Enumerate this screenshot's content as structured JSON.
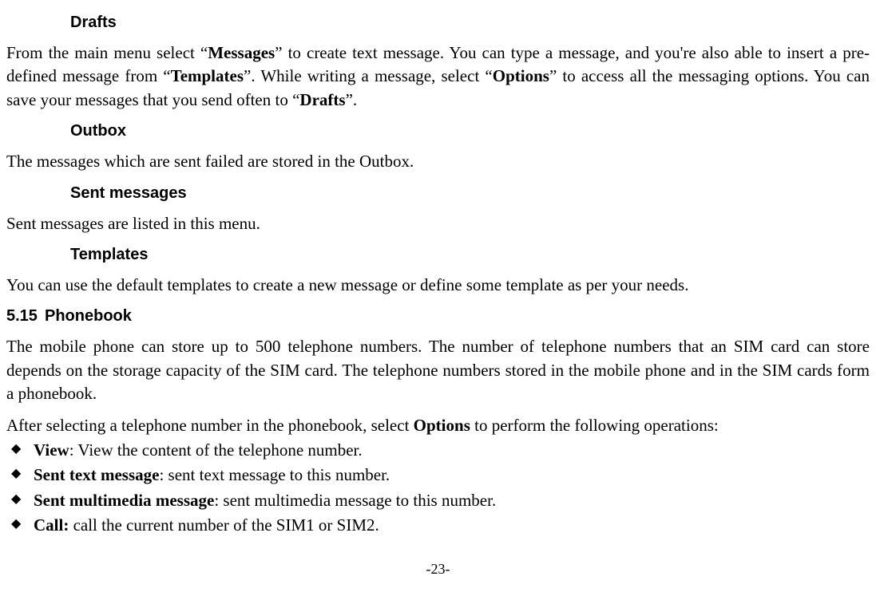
{
  "headings": {
    "drafts": "Drafts",
    "outbox": "Outbox",
    "sent_messages": "Sent messages",
    "templates": "Templates",
    "phonebook_num": "5.15",
    "phonebook": "Phonebook"
  },
  "drafts_para": {
    "t1": "From the main menu select “",
    "b1": "Messages",
    "t2": "” to create text message. You can type a message, and you're also able to insert a pre-defined message from “",
    "b2": "Templates",
    "t3": "”. While writing a message, select “",
    "b3": "Options",
    "t4": "” to access all the messaging options. You can save your messages that you send often to “",
    "b4": "Drafts",
    "t5": "”."
  },
  "outbox_para": "The messages which are sent failed are stored in the Outbox.",
  "sent_para": "Sent messages are listed in this menu.",
  "templates_para": "You can use the default templates to create a new message or define some template as per your needs.",
  "phonebook_para1": "The mobile phone can store up to 500 telephone numbers. The number of telephone numbers that an SIM card can store depends on the storage capacity of the SIM card. The telephone numbers stored in the mobile phone and in the SIM cards form a phonebook.",
  "phonebook_para2": {
    "t1": "After selecting a telephone number in the phonebook, select ",
    "b1": "Options",
    "t2": " to perform the following operations:"
  },
  "bullets": {
    "b0_label": "View",
    "b0_text": ": View the content of the telephone number.",
    "b1_label": "Sent text message",
    "b1_text": ": sent text message to this number.",
    "b2_label": "Sent multimedia message",
    "b2_text": ": sent multimedia message to this number.",
    "b3_label": "Call:",
    "b3_text": " call the current number of the SIM1 or SIM2."
  },
  "page_number": "-23-"
}
